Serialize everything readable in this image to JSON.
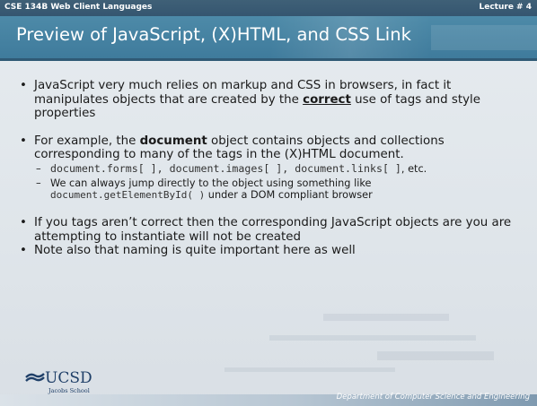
{
  "header": {
    "course": "CSE 134B  Web Client Languages",
    "lecture": "Lecture # 4"
  },
  "slide": {
    "title": "Preview of JavaScript, (X)HTML, and CSS Link"
  },
  "bullets": [
    {
      "pre": "JavaScript very much relies on markup and CSS in browsers, in fact it manipulates objects that are created by the ",
      "emph": "correct",
      "post": " use of tags and style properties"
    },
    {
      "pre": "For example, the ",
      "emph": "document",
      "post": " object contains objects and collections corresponding to many of the tags in the (X)HTML document.",
      "subs": [
        {
          "code": "document.forms[ ], document.images[ ], document.links[ ]",
          "post": ", etc."
        },
        {
          "text": "We can always jump directly to the object using something like",
          "code": "document.getElementById( )",
          "post": " under a DOM compliant browser"
        }
      ]
    },
    {
      "text": "If you tags aren’t correct then the corresponding JavaScript objects are you are attempting to instantiate will not be created"
    },
    {
      "text": "Note also that naming is quite important here as well"
    }
  ],
  "logo": {
    "name": "UCSD",
    "sub": "Jacobs School"
  },
  "footer": {
    "text": "Department of Computer Science and Engineering"
  }
}
